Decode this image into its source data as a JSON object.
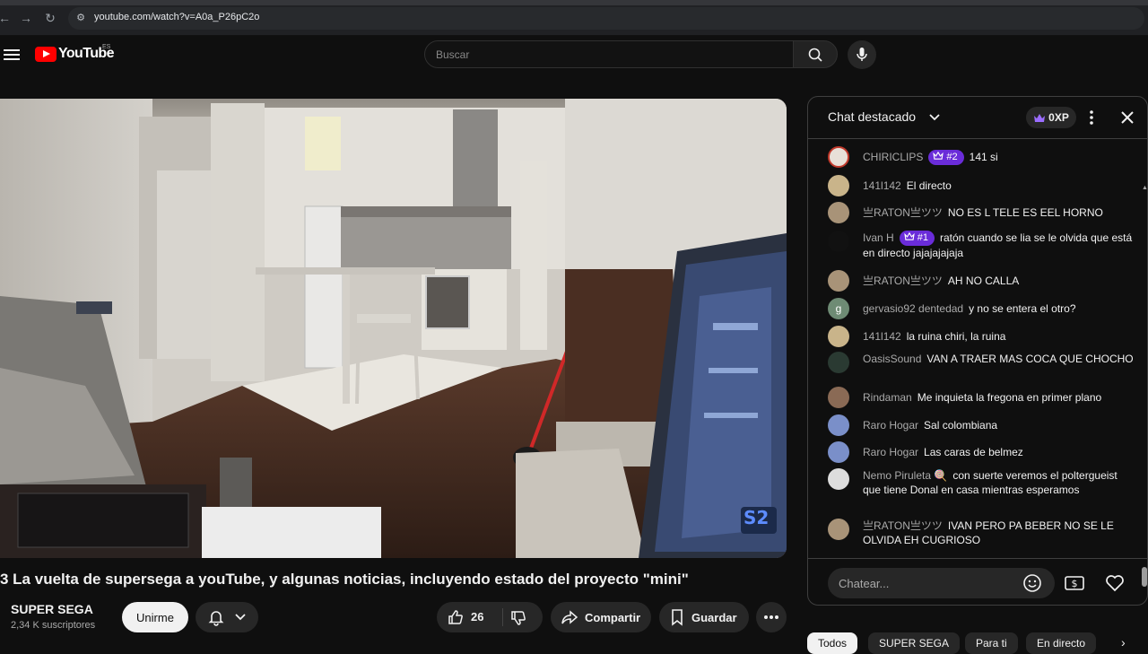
{
  "browser": {
    "url": "youtube.com/watch?v=A0a_P26pC2o"
  },
  "header": {
    "logo_text": "YouTube",
    "country_code": "ES",
    "search_placeholder": "Buscar"
  },
  "video": {
    "title": "3 La vuelta de supersega a youTube, y algunas noticias, incluyendo estado del proyecto \"mini\"",
    "watermark": "S2"
  },
  "channel": {
    "name": "SUPER SEGA",
    "subscribers": "2,34 K suscriptores",
    "subscribe_label": "Unirme"
  },
  "actions": {
    "like_count": "26",
    "share_label": "Compartir",
    "save_label": "Guardar"
  },
  "chat": {
    "title": "Chat destacado",
    "xp_label": "0XP",
    "input_placeholder": "Chatear...",
    "messages": [
      {
        "author": "CHIRICLIPS",
        "rank": "#2",
        "text": "141 si",
        "avatar_color": "#e8e0d8"
      },
      {
        "author": "141l142",
        "rank": "",
        "text": "El directo",
        "avatar_color": "#c9b48a"
      },
      {
        "author": "亗RATON亗ツツ",
        "rank": "",
        "text": "NO ES L TELE ES EEL HORNO",
        "avatar_color": "#a89378"
      },
      {
        "author": "Ivan H",
        "rank": "#1",
        "text": "ratón cuando se lia se le olvida que está en directo jajajajajaja",
        "avatar_color": "#111111"
      },
      {
        "author": "亗RATON亗ツツ",
        "rank": "",
        "text": "AH NO CALLA",
        "avatar_color": "#a89378"
      },
      {
        "author": "gervasio92 dentedad",
        "rank": "",
        "text": "y no se entera el otro?",
        "avatar_color": "#6e8b74",
        "initial": "g"
      },
      {
        "author": "141l142",
        "rank": "",
        "text": "la ruina chiri, la ruina",
        "avatar_color": "#c9b48a"
      },
      {
        "author": "OasisSound",
        "rank": "",
        "text": "VAN A TRAER MAS COCA QUE CHOCHO",
        "avatar_color": "#2a3a32"
      },
      {
        "author": "Rindaman",
        "rank": "",
        "text": "Me inquieta la fregona en primer plano",
        "avatar_color": "#8a6a55"
      },
      {
        "author": "Raro Hogar",
        "rank": "",
        "text": "Sal colombiana",
        "avatar_color": "#7a8fc9"
      },
      {
        "author": "Raro Hogar",
        "rank": "",
        "text": "Las caras de belmez",
        "avatar_color": "#7a8fc9"
      },
      {
        "author": "Nemo Piruleta 🍭",
        "rank": "",
        "text": "con suerte veremos el polterguеist que tiene Donal en casa mientras esperamos",
        "avatar_color": "#dddddd"
      },
      {
        "author": "亗RATON亗ツツ",
        "rank": "",
        "text": "IVAN PERO PA BEBER NO SE LE OLVIDA EH CUGRIOSO",
        "avatar_color": "#a89378"
      }
    ]
  },
  "chips": [
    "Todos",
    "SUPER SEGA",
    "Para ti",
    "En directo"
  ],
  "colors": {
    "accent_red": "#ff0000",
    "rank_purple": "#6a2cd9",
    "background": "#0f0f0f"
  }
}
